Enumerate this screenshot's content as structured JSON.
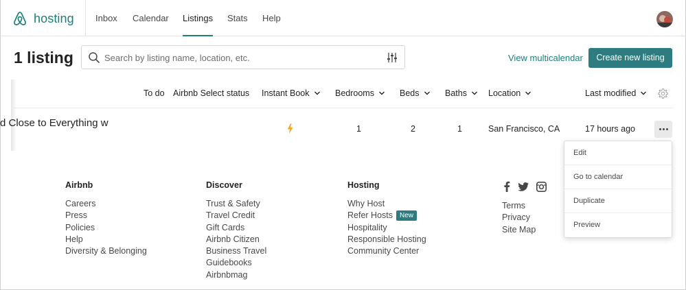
{
  "nav": {
    "brand": "hosting",
    "tabs": [
      {
        "label": "Inbox"
      },
      {
        "label": "Calendar"
      },
      {
        "label": "Listings"
      },
      {
        "label": "Stats"
      },
      {
        "label": "Help"
      }
    ],
    "active_tab": "Listings"
  },
  "header": {
    "title": "1 listing",
    "search_placeholder": "Search by listing name, location, etc.",
    "multicalendar_link": "View multicalendar",
    "create_button": "Create new listing"
  },
  "table": {
    "columns": [
      {
        "label": "To do",
        "dropdown": false
      },
      {
        "label": "Airbnb Select status",
        "dropdown": false
      },
      {
        "label": "Instant Book",
        "dropdown": true
      },
      {
        "label": "Bedrooms",
        "dropdown": true
      },
      {
        "label": "Beds",
        "dropdown": true
      },
      {
        "label": "Baths",
        "dropdown": true
      },
      {
        "label": "Location",
        "dropdown": true
      },
      {
        "label": "Last modified",
        "dropdown": true
      }
    ],
    "rows": [
      {
        "title": "d Close to Everything w",
        "instant_book": true,
        "bedrooms": "1",
        "beds": "2",
        "baths": "1",
        "location": "San Francisco, CA",
        "last_modified": "17 hours ago"
      }
    ]
  },
  "row_menu": {
    "items": [
      "Edit",
      "Go to calendar",
      "Duplicate",
      "Preview"
    ]
  },
  "footer": {
    "airbnb": {
      "heading": "Airbnb",
      "links": [
        "Careers",
        "Press",
        "Policies",
        "Help",
        "Diversity & Belonging"
      ]
    },
    "discover": {
      "heading": "Discover",
      "links": [
        "Trust & Safety",
        "Travel Credit",
        "Gift Cards",
        "Airbnb Citizen",
        "Business Travel",
        "Guidebooks",
        "Airbnbmag"
      ]
    },
    "hosting": {
      "heading": "Hosting",
      "links": [
        "Why Host",
        "Refer Hosts",
        "Hospitality",
        "Responsible Hosting",
        "Community Center"
      ],
      "new_badge": "New"
    },
    "legal": {
      "links": [
        "Terms",
        "Privacy",
        "Site Map"
      ]
    },
    "social_icons": [
      "facebook-icon",
      "twitter-icon",
      "instagram-icon"
    ]
  },
  "colors": {
    "brand": "#1b7f7a",
    "button": "#2f7c80",
    "instant_book": "#f5a623"
  }
}
